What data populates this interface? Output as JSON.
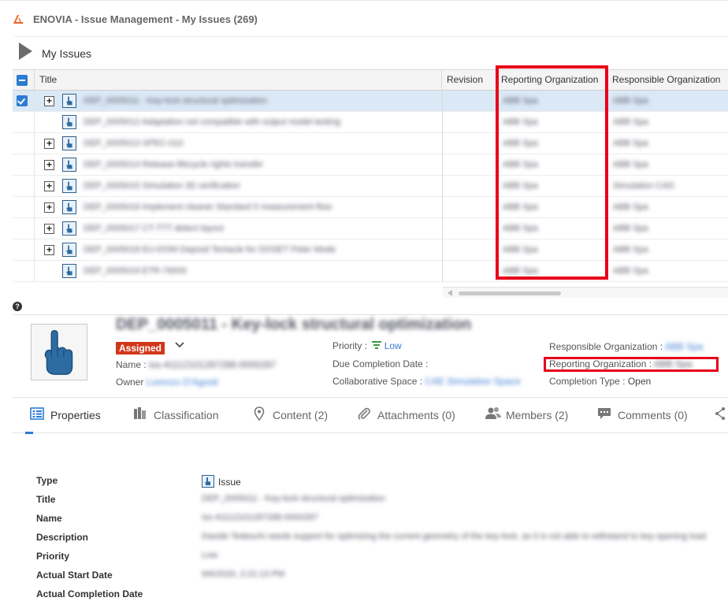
{
  "window": {
    "title": "ENOVIA - Issue Management - My Issues (269)"
  },
  "header": {
    "title": "My Issues"
  },
  "grid": {
    "columns": [
      "Title",
      "Revision",
      "Reporting Organization",
      "Responsible Organization"
    ],
    "rows": [
      {
        "title": "DEP_0005011 - Key-lock structural optimization",
        "revision": "",
        "reporting": "ABB Spa",
        "responsible": "ABB Spa",
        "expandable": true,
        "selected": true
      },
      {
        "title": "DEP_0005012 Adaptation not compatible with output model testing",
        "revision": "",
        "reporting": "ABB Spa",
        "responsible": "ABB Spa",
        "expandable": false,
        "selected": false
      },
      {
        "title": "DEP_0005013 SPEC-010",
        "revision": "",
        "reporting": "ABB Spa",
        "responsible": "ABB Spa",
        "expandable": true,
        "selected": false
      },
      {
        "title": "DEP_0005014 Release-lifecycle rights transfer",
        "revision": "",
        "reporting": "ABB Spa",
        "responsible": "ABB Spa",
        "expandable": true,
        "selected": false
      },
      {
        "title": "DEP_0005015 Simulation 3D verification",
        "revision": "",
        "reporting": "ABB Spa",
        "responsible": "Simulation CAD",
        "expandable": true,
        "selected": false
      },
      {
        "title": "DEP_0005016 Implement cleaner Standard 5 measurement flow",
        "revision": "",
        "reporting": "ABB Spa",
        "responsible": "ABB Spa",
        "expandable": true,
        "selected": false
      },
      {
        "title": "DEP_0005017 CT-TTT detect layout",
        "revision": "",
        "reporting": "ABB Spa",
        "responsible": "ABB Spa",
        "expandable": true,
        "selected": false
      },
      {
        "title": "DEP_0005018 EU-DOM Deposit Tentacle for DOSET Peter Mode",
        "revision": "",
        "reporting": "ABB Spa",
        "responsible": "ABB Spa",
        "expandable": true,
        "selected": false
      },
      {
        "title": "DEP_0005019 ETR-76000",
        "revision": "",
        "reporting": "ABB Spa",
        "responsible": "ABB Spa",
        "expandable": false,
        "selected": false
      }
    ]
  },
  "detail": {
    "title": "DEP_0005011 - Key-lock structural optimization",
    "state": "Assigned",
    "name_label": "Name :",
    "name_value": "iss-41112101287288-0000287",
    "owner_label": "Owner",
    "owner_value": "Lorenzo D'Agosti",
    "priority_label": "Priority :",
    "priority_value": "Low",
    "due_label": "Due Completion Date :",
    "due_value": "",
    "space_label": "Collaborative Space :",
    "space_value": "CAE Simulation Space",
    "resp_label": "Responsible Organization :",
    "resp_value": "ABB Spa",
    "rep_label": "Reporting Organization :",
    "rep_value": "ABB Spa",
    "ctype_label": "Completion Type :",
    "ctype_value": "Open"
  },
  "tabs": [
    {
      "label": "Properties",
      "icon": "properties-icon"
    },
    {
      "label": "Classification",
      "icon": "classification-icon"
    },
    {
      "label": "Content (2)",
      "icon": "location-pin-icon"
    },
    {
      "label": "Attachments (0)",
      "icon": "paperclip-icon"
    },
    {
      "label": "Members (2)",
      "icon": "members-icon"
    },
    {
      "label": "Comments (0)",
      "icon": "comments-icon"
    }
  ],
  "properties": {
    "type": {
      "label": "Type",
      "value": "Issue"
    },
    "title": {
      "label": "Title",
      "value": "DEP_0005011 - Key-lock structural optimization"
    },
    "name": {
      "label": "Name",
      "value": "iss-41112101287288-0000287"
    },
    "description": {
      "label": "Description",
      "value": "Davide Tedeschi needs support for optimizing the current geometry of the key-lock, as it is not able to withstand to key opening load"
    },
    "priority": {
      "label": "Priority",
      "value": "Low"
    },
    "actual_start": {
      "label": "Actual Start Date",
      "value": "9/6/2020, 2:21:13 PM"
    },
    "actual_completion": {
      "label": "Actual Completion Date",
      "value": ""
    }
  },
  "colors": {
    "accent": "#2d7bd1",
    "state_badge": "#d2371b",
    "highlight": "#e8001a"
  }
}
